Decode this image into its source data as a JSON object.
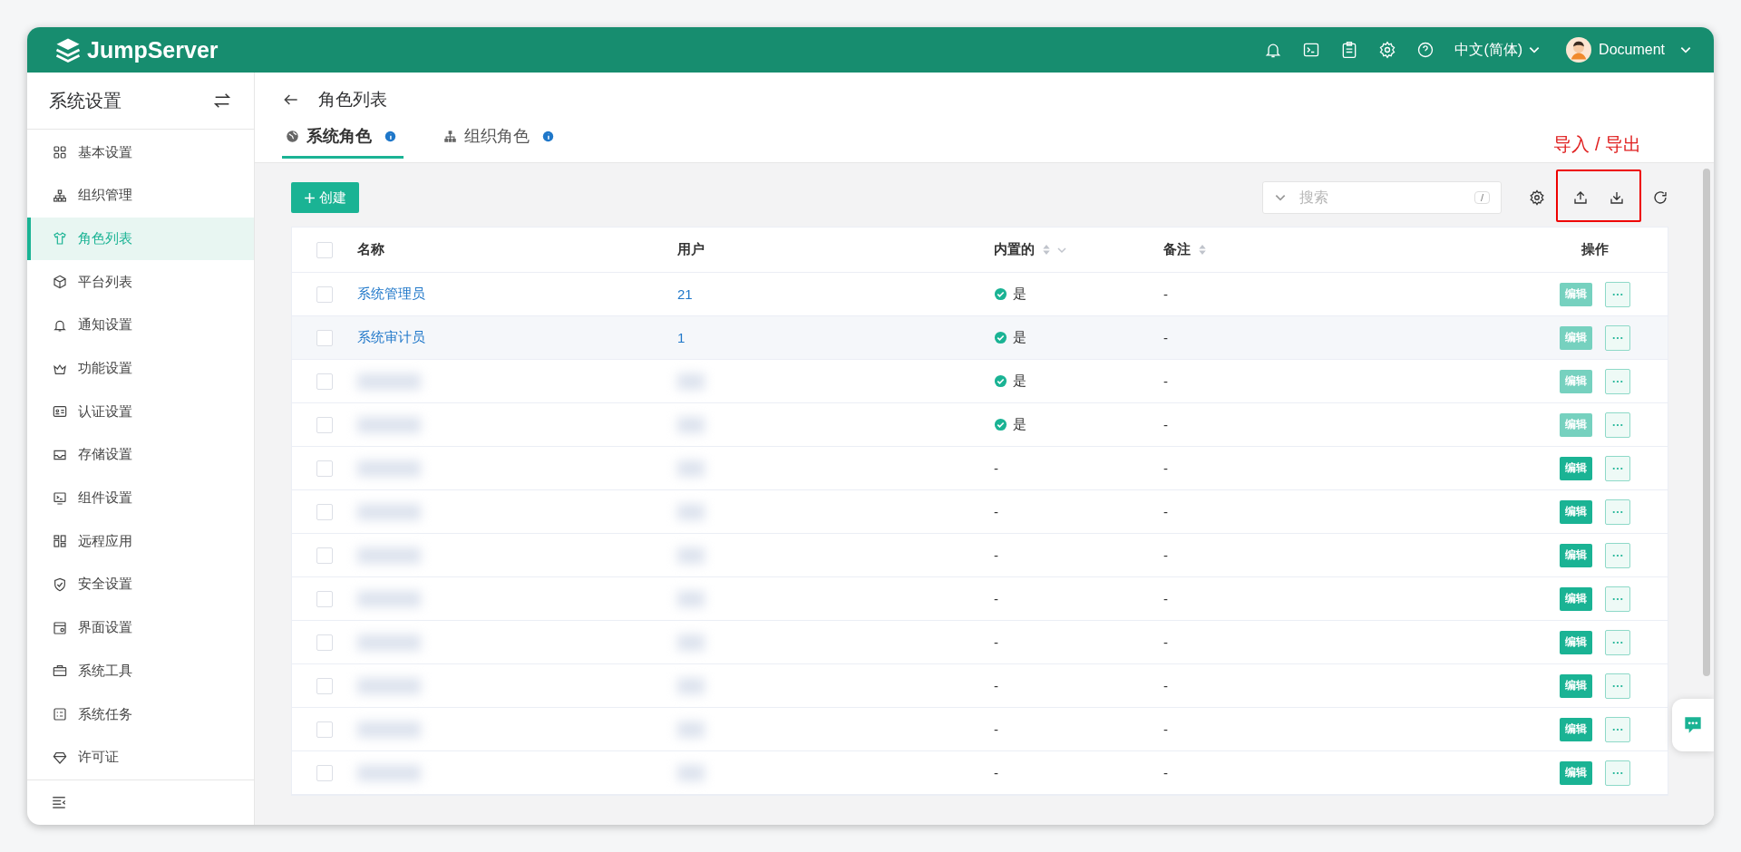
{
  "header": {
    "logo": "JumpServer",
    "language": "中文(简体)",
    "user": "Document"
  },
  "sidebar": {
    "title": "系统设置",
    "items": [
      {
        "label": "基本设置",
        "selected": false
      },
      {
        "label": "组织管理",
        "selected": false
      },
      {
        "label": "角色列表",
        "selected": true
      },
      {
        "label": "平台列表",
        "selected": false
      },
      {
        "label": "通知设置",
        "selected": false
      },
      {
        "label": "功能设置",
        "selected": false
      },
      {
        "label": "认证设置",
        "selected": false
      },
      {
        "label": "存储设置",
        "selected": false
      },
      {
        "label": "组件设置",
        "selected": false
      },
      {
        "label": "远程应用",
        "selected": false
      },
      {
        "label": "安全设置",
        "selected": false
      },
      {
        "label": "界面设置",
        "selected": false
      },
      {
        "label": "系统工具",
        "selected": false
      },
      {
        "label": "系统任务",
        "selected": false
      },
      {
        "label": "许可证",
        "selected": false
      }
    ]
  },
  "page": {
    "title": "角色列表",
    "tabs": [
      {
        "label": "系统角色",
        "selected": true
      },
      {
        "label": "组织角色",
        "selected": false
      }
    ],
    "annotation": "导入 / 导出"
  },
  "toolbar": {
    "create": "创建",
    "search_placeholder": "搜索",
    "search_shortcut": "/"
  },
  "table": {
    "all_checked": false,
    "columns": [
      "名称",
      "用户",
      "内置的",
      "备注",
      "操作"
    ],
    "rows": [
      {
        "checked": false,
        "name": "系统管理员",
        "users": "21",
        "builtin": true,
        "builtin_label": "是",
        "note": "-",
        "edit": "编辑",
        "editable": false,
        "hovered": false
      },
      {
        "checked": false,
        "name": "系统审计员",
        "users": "1",
        "builtin": true,
        "builtin_label": "是",
        "note": "-",
        "edit": "编辑",
        "editable": false,
        "hovered": true
      },
      {
        "checked": false,
        "blurred": true,
        "builtin": true,
        "builtin_label": "是",
        "note": "-",
        "edit": "编辑",
        "editable": false,
        "hovered": false
      },
      {
        "checked": false,
        "blurred": true,
        "builtin": true,
        "builtin_label": "是",
        "note": "-",
        "edit": "编辑",
        "editable": false,
        "hovered": false
      },
      {
        "checked": false,
        "blurred": true,
        "builtin": false,
        "builtin_label": "-",
        "note": "-",
        "edit": "编辑",
        "editable": true,
        "hovered": false
      },
      {
        "checked": false,
        "blurred": true,
        "builtin": false,
        "builtin_label": "-",
        "note": "-",
        "edit": "编辑",
        "editable": true,
        "hovered": false
      },
      {
        "checked": false,
        "blurred": true,
        "builtin": false,
        "builtin_label": "-",
        "note": "-",
        "edit": "编辑",
        "editable": true,
        "hovered": false
      },
      {
        "checked": false,
        "blurred": true,
        "builtin": false,
        "builtin_label": "-",
        "note": "-",
        "edit": "编辑",
        "editable": true,
        "hovered": false
      },
      {
        "checked": false,
        "blurred": true,
        "builtin": false,
        "builtin_label": "-",
        "note": "-",
        "edit": "编辑",
        "editable": true,
        "hovered": false
      },
      {
        "checked": false,
        "blurred": true,
        "builtin": false,
        "builtin_label": "-",
        "note": "-",
        "edit": "编辑",
        "editable": true,
        "hovered": false
      },
      {
        "checked": false,
        "blurred": true,
        "builtin": false,
        "builtin_label": "-",
        "note": "-",
        "edit": "编辑",
        "editable": true,
        "hovered": false
      },
      {
        "checked": false,
        "blurred": true,
        "builtin": false,
        "builtin_label": "-",
        "note": "-",
        "edit": "编辑",
        "editable": true,
        "hovered": false
      }
    ]
  }
}
